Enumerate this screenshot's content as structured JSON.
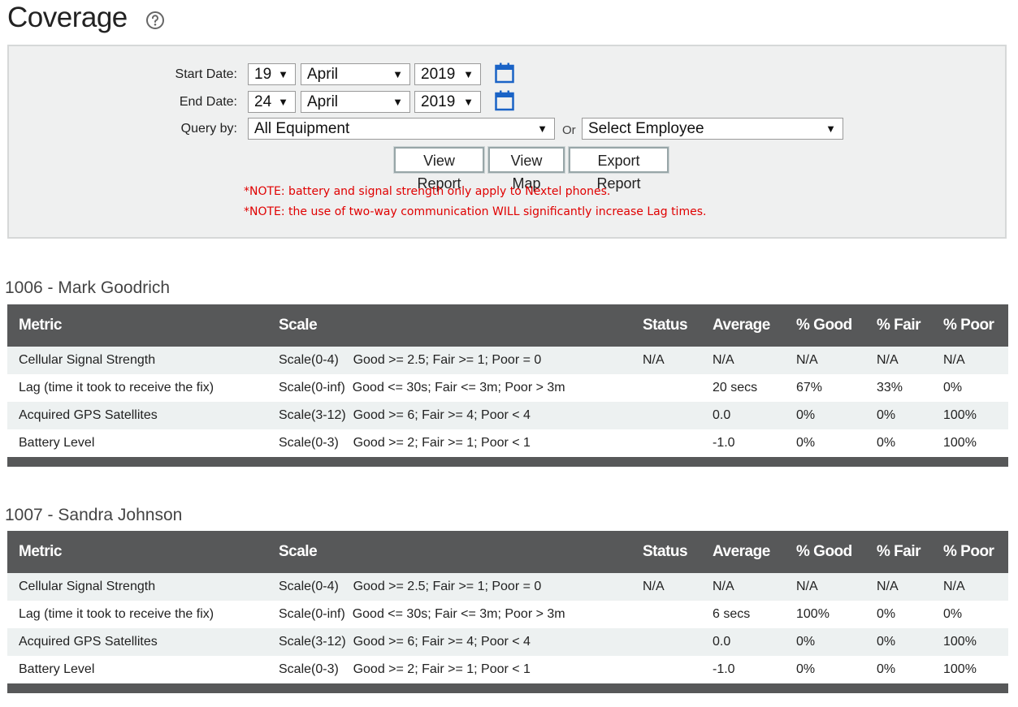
{
  "page": {
    "title": "Coverage"
  },
  "filters": {
    "start_label": "Start Date:",
    "start_day": "19",
    "start_month": "April",
    "start_year": "2019",
    "end_label": "End Date:",
    "end_day": "24",
    "end_month": "April",
    "end_year": "2019",
    "query_label": "Query by:",
    "equipment_value": "All Equipment",
    "or_label": "Or",
    "employee_value": "Select Employee",
    "buttons": {
      "view_report": "View Report",
      "view_map": "View Map",
      "export_report": "Export Report"
    },
    "notes": [
      "*NOTE: battery and signal strength only apply to Nextel phones.",
      "*NOTE: the use of two-way communication WILL significantly increase Lag times."
    ]
  },
  "columns": [
    "Metric",
    "Scale",
    "Status",
    "Average",
    "% Good",
    "% Fair",
    "% Poor"
  ],
  "reports": [
    {
      "title": "1006 - Mark Goodrich",
      "rows": [
        {
          "metric": "Cellular Signal Strength",
          "scale": "Scale(0-4)    Good >= 2.5; Fair >= 1; Poor = 0",
          "status": "N/A",
          "average": "N/A",
          "good": "N/A",
          "fair": "N/A",
          "poor": "N/A"
        },
        {
          "metric": "Lag (time it took to receive the fix)",
          "scale": "Scale(0-inf)  Good <= 30s; Fair <= 3m; Poor > 3m",
          "status": "",
          "average": "20 secs",
          "good": "67%",
          "fair": "33%",
          "poor": "0%"
        },
        {
          "metric": "Acquired GPS Satellites",
          "scale": "Scale(3-12)  Good >= 6; Fair >= 4; Poor < 4",
          "status": "",
          "average": "0.0",
          "good": "0%",
          "fair": "0%",
          "poor": "100%"
        },
        {
          "metric": "Battery Level",
          "scale": "Scale(0-3)    Good >= 2; Fair >= 1; Poor < 1",
          "status": "",
          "average": "-1.0",
          "good": "0%",
          "fair": "0%",
          "poor": "100%"
        }
      ]
    },
    {
      "title": "1007 - Sandra Johnson",
      "rows": [
        {
          "metric": "Cellular Signal Strength",
          "scale": "Scale(0-4)    Good >= 2.5; Fair >= 1; Poor = 0",
          "status": "N/A",
          "average": "N/A",
          "good": "N/A",
          "fair": "N/A",
          "poor": "N/A"
        },
        {
          "metric": "Lag (time it took to receive the fix)",
          "scale": "Scale(0-inf)  Good <= 30s; Fair <= 3m; Poor > 3m",
          "status": "",
          "average": "6 secs",
          "good": "100%",
          "fair": "0%",
          "poor": "0%"
        },
        {
          "metric": "Acquired GPS Satellites",
          "scale": "Scale(3-12)  Good >= 6; Fair >= 4; Poor < 4",
          "status": "",
          "average": "0.0",
          "good": "0%",
          "fair": "0%",
          "poor": "100%"
        },
        {
          "metric": "Battery Level",
          "scale": "Scale(0-3)    Good >= 2; Fair >= 1; Poor < 1",
          "status": "",
          "average": "-1.0",
          "good": "0%",
          "fair": "0%",
          "poor": "100%"
        }
      ]
    }
  ],
  "colors": {
    "header_bg": "#575859",
    "panel_bg": "#eff0f0",
    "note_red": "#e00000",
    "calendar_blue": "#1a63c6"
  }
}
